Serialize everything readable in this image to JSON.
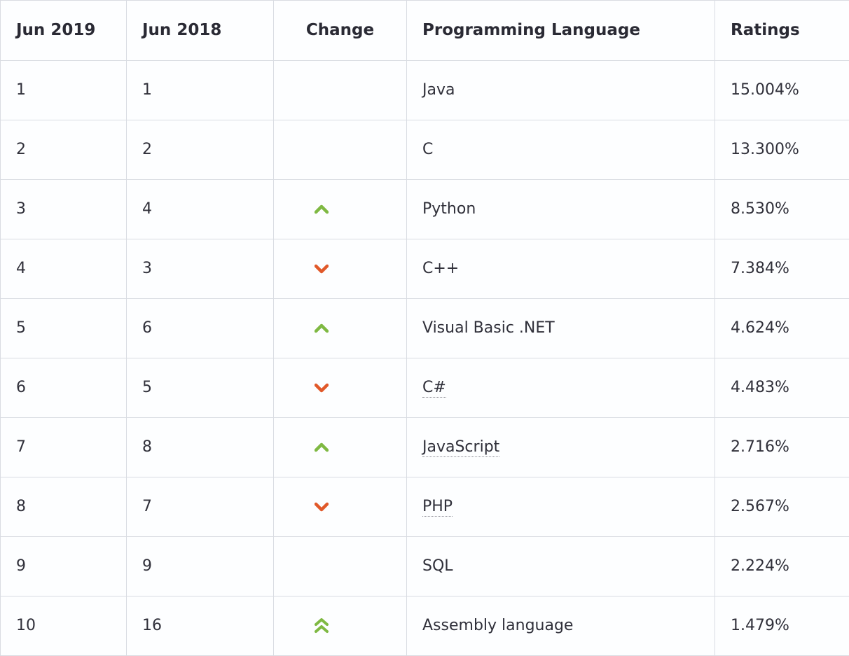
{
  "headers": {
    "col1": "Jun 2019",
    "col2": "Jun 2018",
    "col3": "Change",
    "col4": "Programming Language",
    "col5": "Ratings"
  },
  "icon_colors": {
    "up": "#7fb943",
    "down": "#e1592a",
    "double_up": "#7fb943"
  },
  "rows": [
    {
      "rank_now": "1",
      "rank_prev": "1",
      "change": "",
      "language": "Java",
      "rating": "15.004%",
      "dotted": false
    },
    {
      "rank_now": "2",
      "rank_prev": "2",
      "change": "",
      "language": "C",
      "rating": "13.300%",
      "dotted": false
    },
    {
      "rank_now": "3",
      "rank_prev": "4",
      "change": "up",
      "language": "Python",
      "rating": "8.530%",
      "dotted": false
    },
    {
      "rank_now": "4",
      "rank_prev": "3",
      "change": "down",
      "language": "C++",
      "rating": "7.384%",
      "dotted": false
    },
    {
      "rank_now": "5",
      "rank_prev": "6",
      "change": "up",
      "language": "Visual Basic .NET",
      "rating": "4.624%",
      "dotted": false
    },
    {
      "rank_now": "6",
      "rank_prev": "5",
      "change": "down",
      "language": "C#",
      "rating": "4.483%",
      "dotted": true
    },
    {
      "rank_now": "7",
      "rank_prev": "8",
      "change": "up",
      "language": "JavaScript",
      "rating": "2.716%",
      "dotted": true
    },
    {
      "rank_now": "8",
      "rank_prev": "7",
      "change": "down",
      "language": "PHP",
      "rating": "2.567%",
      "dotted": true
    },
    {
      "rank_now": "9",
      "rank_prev": "9",
      "change": "",
      "language": "SQL",
      "rating": "2.224%",
      "dotted": false
    },
    {
      "rank_now": "10",
      "rank_prev": "16",
      "change": "double_up",
      "language": "Assembly language",
      "rating": "1.479%",
      "dotted": false
    }
  ],
  "chart_data": {
    "type": "table",
    "title": "TIOBE Programming Community Index",
    "columns": [
      "Jun 2019",
      "Jun 2018",
      "Change",
      "Programming Language",
      "Ratings"
    ],
    "data": [
      [
        1,
        1,
        "same",
        "Java",
        15.004
      ],
      [
        2,
        2,
        "same",
        "C",
        13.3
      ],
      [
        3,
        4,
        "up",
        "Python",
        8.53
      ],
      [
        4,
        3,
        "down",
        "C++",
        7.384
      ],
      [
        5,
        6,
        "up",
        "Visual Basic .NET",
        4.624
      ],
      [
        6,
        5,
        "down",
        "C#",
        4.483
      ],
      [
        7,
        8,
        "up",
        "JavaScript",
        2.716
      ],
      [
        8,
        7,
        "down",
        "PHP",
        2.567
      ],
      [
        9,
        9,
        "same",
        "SQL",
        2.224
      ],
      [
        10,
        16,
        "double_up",
        "Assembly language",
        1.479
      ]
    ]
  }
}
